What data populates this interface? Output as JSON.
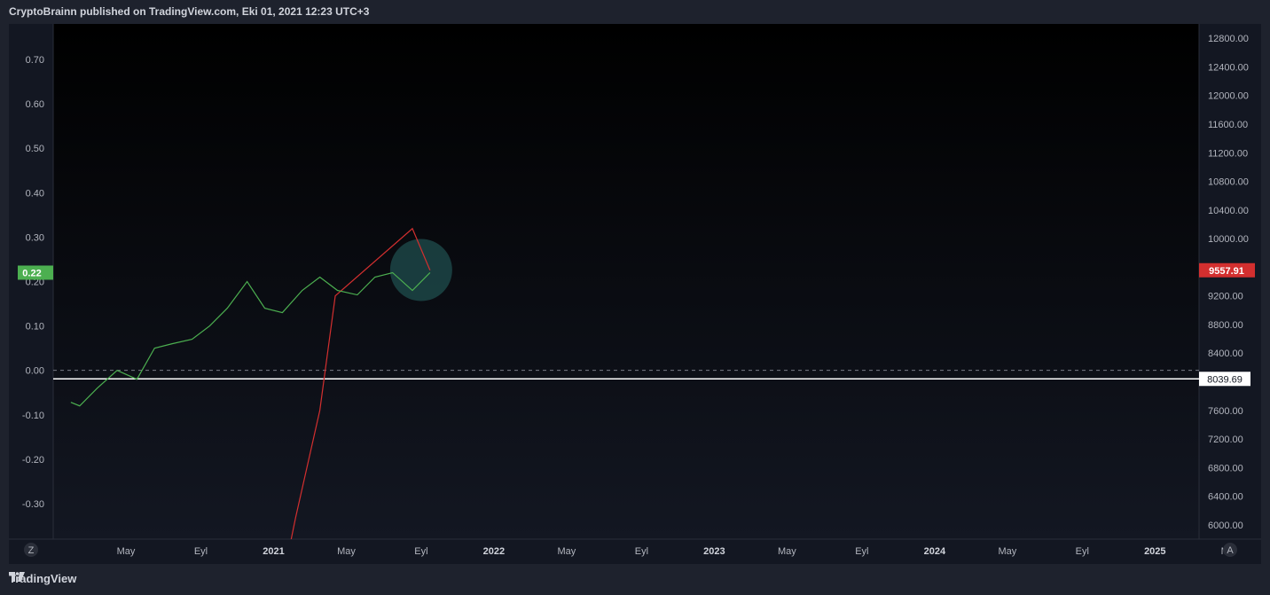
{
  "header": {
    "text": "CryptoBrainn published on TradingView.com, Eki 01, 2021 12:23 UTC+3"
  },
  "footer": {
    "brand": "TradingView"
  },
  "corner_buttons": {
    "left": "Z",
    "right": "A"
  },
  "colors": {
    "background": "#131722",
    "panel": "#1e222d",
    "green_series": "#4caf50",
    "red_series": "#d32f2f",
    "highlight": "#1f4d4d"
  },
  "chart_data": {
    "type": "line",
    "left_axis": {
      "ticks": [
        "0.70",
        "0.60",
        "0.50",
        "0.40",
        "0.30",
        "0.20",
        "0.10",
        "0.00",
        "-0.10",
        "-0.20",
        "-0.30"
      ],
      "ylim": [
        -0.38,
        0.78
      ],
      "label_value": "0.22",
      "label_display": "0.22"
    },
    "right_axis": {
      "ticks": [
        "12800.00",
        "12400.00",
        "12000.00",
        "11600.00",
        "11200.00",
        "10800.00",
        "10400.00",
        "10000.00",
        "9200.00",
        "8800.00",
        "8400.00",
        "7600.00",
        "7200.00",
        "6800.00",
        "6400.00",
        "6000.00"
      ],
      "ylim": [
        5800,
        13000
      ],
      "price_label": "9557.91",
      "baseline_label": "8039.69",
      "baseline_value": 8039.69
    },
    "x_axis": {
      "ticks": [
        "May",
        "Eyl",
        "2021",
        "May",
        "Eyl",
        "2022",
        "May",
        "Eyl",
        "2023",
        "May",
        "Eyl",
        "2024",
        "May",
        "Eyl",
        "2025",
        "Ma"
      ]
    },
    "series": [
      {
        "axis": "left",
        "points": [
          [
            2020.08,
            -0.072
          ],
          [
            2020.12,
            -0.08
          ],
          [
            2020.2,
            -0.04
          ],
          [
            2020.29,
            0.0
          ],
          [
            2020.38,
            -0.02
          ],
          [
            2020.46,
            0.05
          ],
          [
            2020.54,
            0.06
          ],
          [
            2020.63,
            0.07
          ],
          [
            2020.71,
            0.1
          ],
          [
            2020.79,
            0.14
          ],
          [
            2020.88,
            0.2
          ],
          [
            2020.96,
            0.14
          ],
          [
            2021.04,
            0.13
          ],
          [
            2021.13,
            0.18
          ],
          [
            2021.21,
            0.21
          ],
          [
            2021.29,
            0.18
          ],
          [
            2021.38,
            0.17
          ],
          [
            2021.46,
            0.21
          ],
          [
            2021.54,
            0.22
          ],
          [
            2021.63,
            0.18
          ],
          [
            2021.71,
            0.22
          ]
        ]
      },
      {
        "axis": "right",
        "points": [
          [
            2021.08,
            5800
          ],
          [
            2021.1,
            6100
          ],
          [
            2021.21,
            7600
          ],
          [
            2021.28,
            9200
          ],
          [
            2021.63,
            10140
          ],
          [
            2021.71,
            9557.91
          ]
        ]
      }
    ],
    "highlight_point": {
      "x": 2021.71,
      "y": 0.22
    }
  }
}
